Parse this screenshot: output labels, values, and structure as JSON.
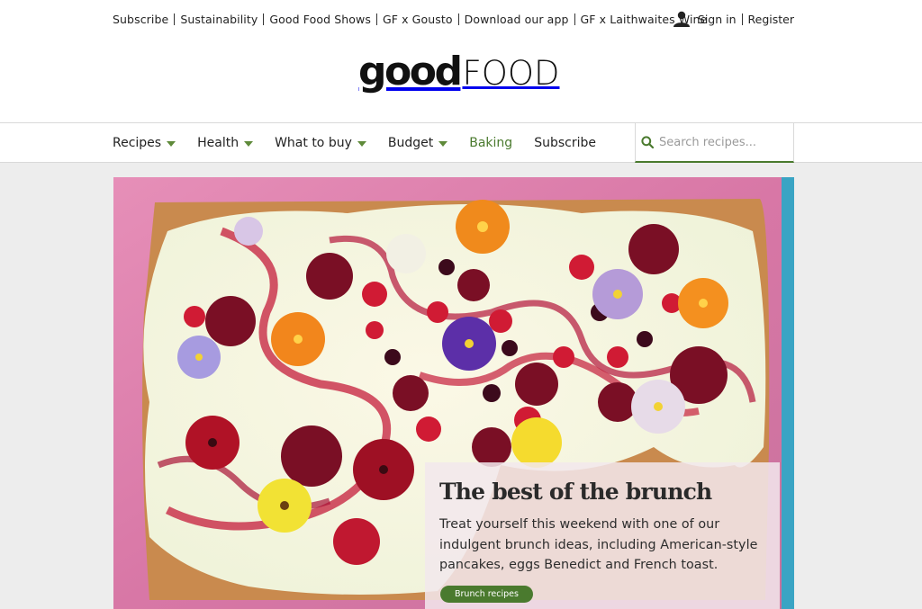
{
  "utility_links": [
    "Subscribe",
    "Sustainability",
    "Good Food Shows",
    "GF x Gousto",
    "Download our app",
    "GF x Laithwaites Wine"
  ],
  "account": {
    "sign_in": "Sign in",
    "register": "Register"
  },
  "logo": {
    "good": "good",
    "food": "FOOD"
  },
  "nav": [
    {
      "label": "Recipes",
      "dropdown": true
    },
    {
      "label": "Health",
      "dropdown": true
    },
    {
      "label": "What to buy",
      "dropdown": true
    },
    {
      "label": "Budget",
      "dropdown": true
    },
    {
      "label": "Baking",
      "dropdown": false
    },
    {
      "label": "Subscribe",
      "dropdown": false
    }
  ],
  "search": {
    "placeholder": "Search recipes..."
  },
  "hero": {
    "title": "The best of the brunch",
    "description": "Treat yourself this weekend with one of our indulgent brunch ideas, including American-style pancakes, eggs Benedict and French toast.",
    "button": "Brunch recipes"
  },
  "colors": {
    "accent_green": "#4a7a2e",
    "hero_background": "#dd7fa8",
    "cake": "#c98a4e"
  },
  "icons": {
    "account": "user-icon",
    "search": "search-icon",
    "dropdown": "caret-down-icon"
  }
}
